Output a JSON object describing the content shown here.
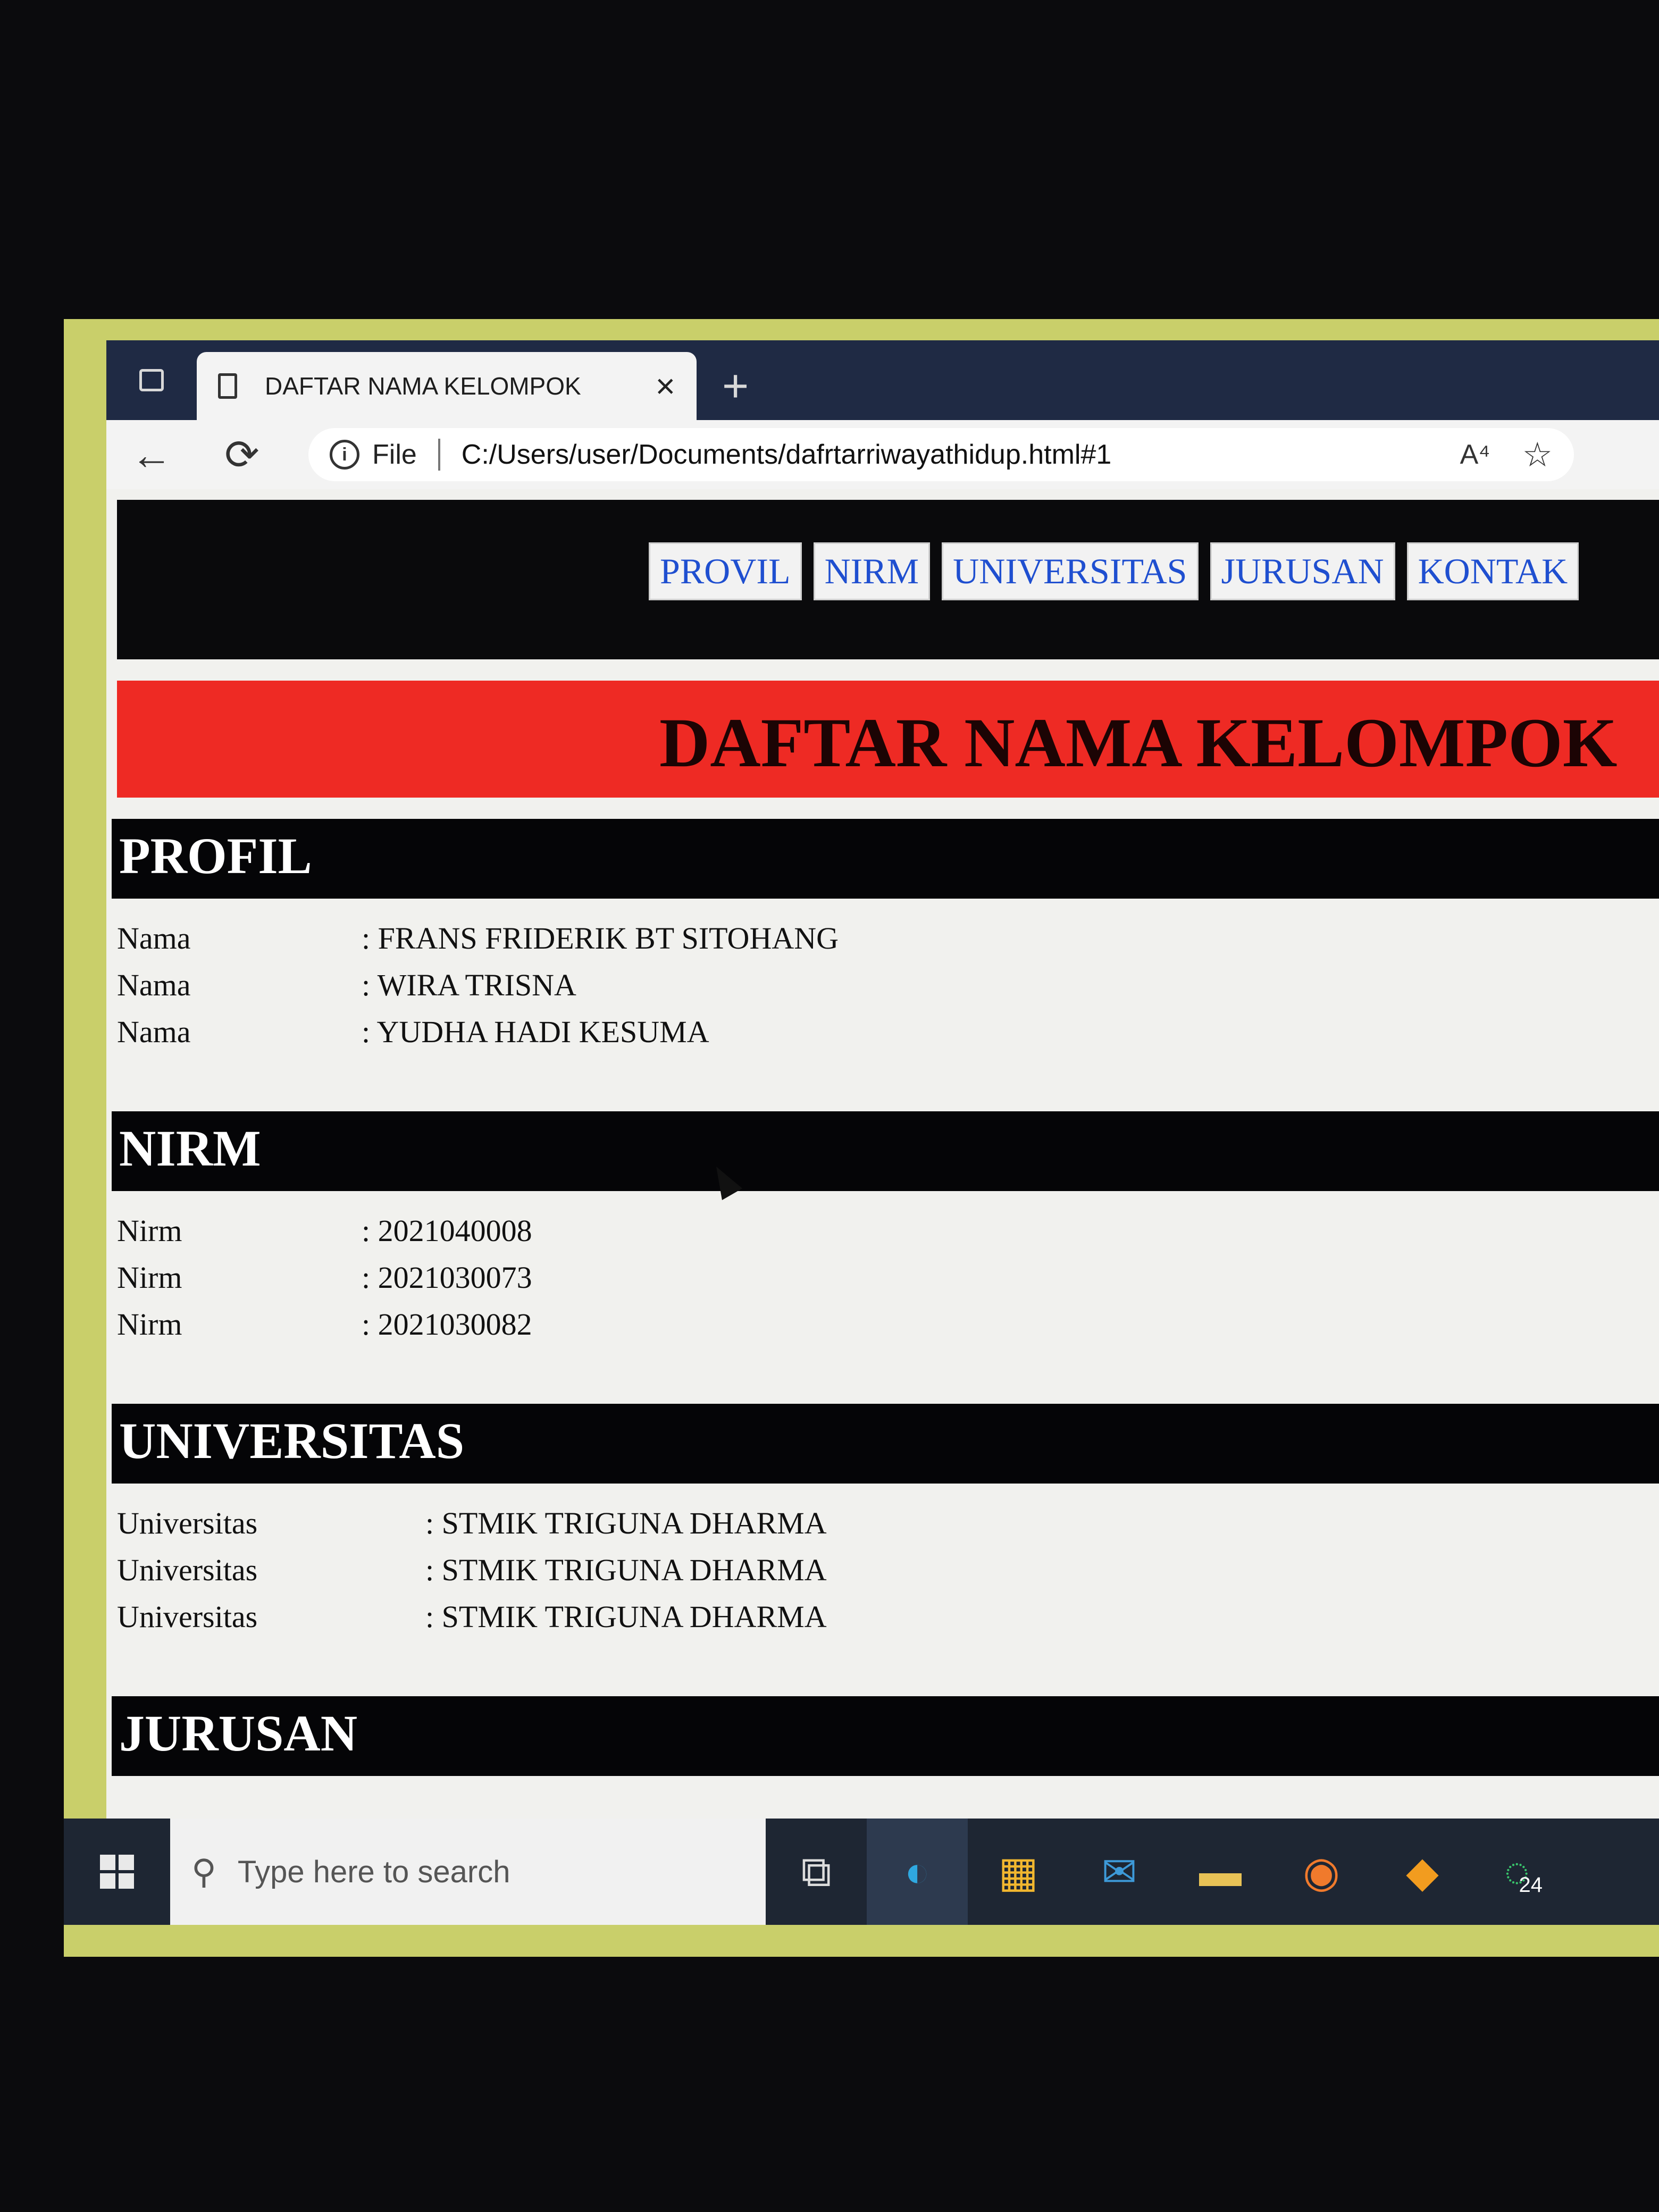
{
  "browser": {
    "tab_title": "DAFTAR NAMA KELOMPOK",
    "close_glyph": "×",
    "new_tab_glyph": "+",
    "back_glyph": "←",
    "refresh_glyph": "⟳",
    "info_glyph": "i",
    "scheme_label": "File",
    "url": "C:/Users/user/Documents/dafrtarriwayathidup.html#1",
    "read_aloud_glyph": "A⁴",
    "favorite_glyph": "☆"
  },
  "nav": {
    "links": [
      "PROVIL",
      "NIRM",
      "UNIVERSITAS",
      "JURUSAN",
      "KONTAK"
    ]
  },
  "banner": {
    "title": "DAFTAR NAMA KELOMPOK"
  },
  "sections": {
    "profil": {
      "heading": "PROFIL",
      "rows": [
        {
          "label": "Nama",
          "value": ": FRANS FRIDERIK BT SITOHANG"
        },
        {
          "label": "Nama",
          "value": ": WIRA TRISNA"
        },
        {
          "label": "Nama",
          "value": ": YUDHA HADI KESUMA"
        }
      ]
    },
    "nirm": {
      "heading": "NIRM",
      "rows": [
        {
          "label": "Nirm",
          "value": ": 2021040008"
        },
        {
          "label": "Nirm",
          "value": ": 2021030073"
        },
        {
          "label": "Nirm",
          "value": ": 2021030082"
        }
      ]
    },
    "universitas": {
      "heading": "UNIVERSITAS",
      "rows": [
        {
          "label": "Universitas",
          "value": ": STMIK TRIGUNA DHARMA"
        },
        {
          "label": "Universitas",
          "value": ": STMIK TRIGUNA DHARMA"
        },
        {
          "label": "Universitas",
          "value": ": STMIK TRIGUNA DHARMA"
        }
      ]
    },
    "jurusan": {
      "heading": "JURUSAN"
    }
  },
  "taskbar": {
    "search_placeholder": "Type here to search",
    "search_glyph": "⚲",
    "whatsapp_badge": "24",
    "icons": {
      "task_view": "⧉",
      "edge": "◐",
      "store": "▦",
      "mail": "✉",
      "explorer": "▬",
      "firefox": "◉",
      "sublime": "◆",
      "whatsapp": "◌"
    }
  }
}
